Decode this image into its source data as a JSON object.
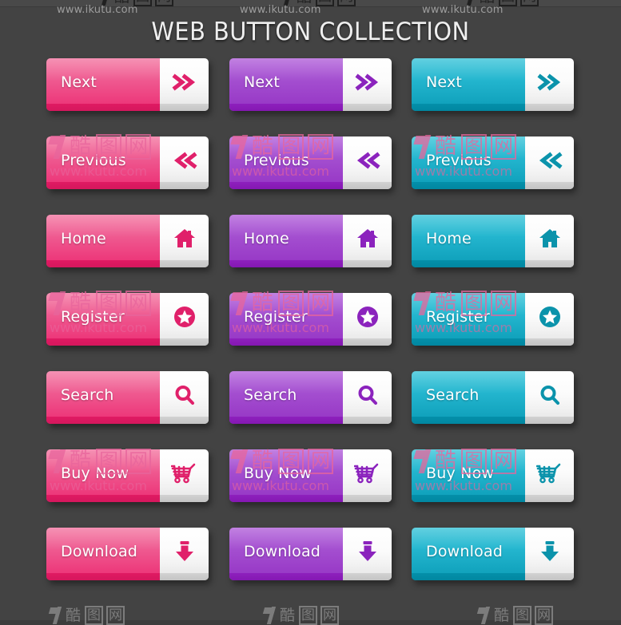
{
  "page": {
    "title": "WEB BUTTON COLLECTION",
    "background_color": "#434343"
  },
  "watermarks": {
    "url_text": "www.ikutu.com",
    "logo_cjk": "酷",
    "logo_box_1": "图",
    "logo_box_2": "网",
    "top_urls": [
      "www.ikutu.com",
      "www.ikutu.com",
      "www.ikutu.com"
    ],
    "overlay_color": "#e8659c"
  },
  "themes": [
    {
      "name": "pink",
      "accent": "#ec2d73",
      "label_top": "#f3739f",
      "label_bottom": "#ec2d73",
      "lip": "#e01a63"
    },
    {
      "name": "purple",
      "accent": "#9534c4",
      "label_top": "#b05ed9",
      "label_bottom": "#9534c4",
      "lip": "#8e20bd"
    },
    {
      "name": "teal",
      "accent": "#0b9cb7",
      "label_top": "#36c3d8",
      "label_bottom": "#0b9cb7",
      "lip": "#0490aa"
    }
  ],
  "buttons": {
    "rows": [
      {
        "label": "Next",
        "icon": "double-chevron-right-icon"
      },
      {
        "label": "Previous",
        "icon": "double-chevron-left-icon"
      },
      {
        "label": "Home",
        "icon": "home-icon"
      },
      {
        "label": "Register",
        "icon": "star-circle-icon"
      },
      {
        "label": "Search",
        "icon": "search-icon"
      },
      {
        "label": "Buy Now",
        "icon": "shopping-cart-icon"
      },
      {
        "label": "Download",
        "icon": "download-arrow-icon"
      }
    ]
  }
}
